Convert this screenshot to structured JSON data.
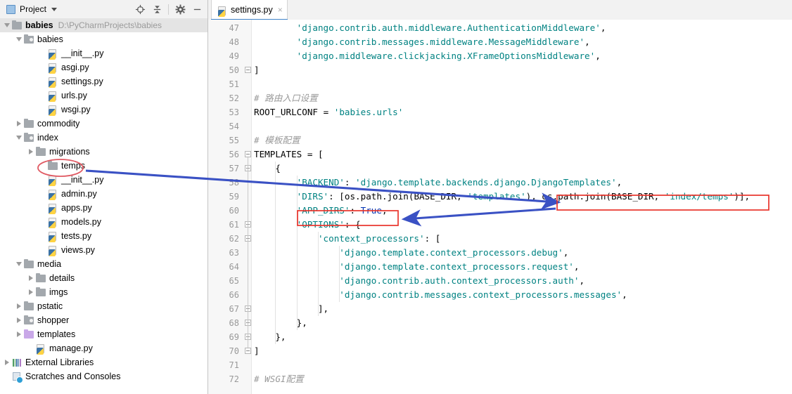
{
  "sidebar": {
    "title": "Project",
    "title_icon": "project-window-icon",
    "tools": [
      {
        "name": "locate-target-icon",
        "label": "Select Opened File"
      },
      {
        "name": "collapse-all-icon",
        "label": "Collapse All"
      },
      {
        "name": "gear-icon",
        "label": "Settings"
      },
      {
        "name": "minimize-icon",
        "label": "Hide"
      }
    ],
    "tree": [
      {
        "label": "babies",
        "path": "D:\\PyCharmProjects\\babies",
        "icon": "folder-icon",
        "state": "expanded",
        "depth": 0,
        "bold": true,
        "selected": true
      },
      {
        "label": "babies",
        "path": "",
        "icon": "module-folder-icon",
        "state": "expanded",
        "depth": 1,
        "bold": false,
        "selected": false
      },
      {
        "label": "__init__.py",
        "path": "",
        "icon": "python-file-icon",
        "state": "leaf",
        "depth": 3,
        "bold": false,
        "selected": false
      },
      {
        "label": "asgi.py",
        "path": "",
        "icon": "python-file-icon",
        "state": "leaf",
        "depth": 3,
        "bold": false,
        "selected": false
      },
      {
        "label": "settings.py",
        "path": "",
        "icon": "python-file-icon",
        "state": "leaf",
        "depth": 3,
        "bold": false,
        "selected": false
      },
      {
        "label": "urls.py",
        "path": "",
        "icon": "python-file-icon",
        "state": "leaf",
        "depth": 3,
        "bold": false,
        "selected": false
      },
      {
        "label": "wsgi.py",
        "path": "",
        "icon": "python-file-icon",
        "state": "leaf",
        "depth": 3,
        "bold": false,
        "selected": false
      },
      {
        "label": "commodity",
        "path": "",
        "icon": "folder-icon",
        "state": "collapsed",
        "depth": 1,
        "bold": false,
        "selected": false
      },
      {
        "label": "index",
        "path": "",
        "icon": "module-folder-icon",
        "state": "expanded",
        "depth": 1,
        "bold": false,
        "selected": false
      },
      {
        "label": "migrations",
        "path": "",
        "icon": "folder-icon",
        "state": "collapsed",
        "depth": 2,
        "bold": false,
        "selected": false
      },
      {
        "label": "temps",
        "path": "",
        "icon": "folder-icon",
        "state": "leaf",
        "depth": 3,
        "bold": false,
        "selected": false
      },
      {
        "label": "__init__.py",
        "path": "",
        "icon": "python-file-icon",
        "state": "leaf",
        "depth": 3,
        "bold": false,
        "selected": false
      },
      {
        "label": "admin.py",
        "path": "",
        "icon": "python-file-icon",
        "state": "leaf",
        "depth": 3,
        "bold": false,
        "selected": false
      },
      {
        "label": "apps.py",
        "path": "",
        "icon": "python-file-icon",
        "state": "leaf",
        "depth": 3,
        "bold": false,
        "selected": false
      },
      {
        "label": "models.py",
        "path": "",
        "icon": "python-file-icon",
        "state": "leaf",
        "depth": 3,
        "bold": false,
        "selected": false
      },
      {
        "label": "tests.py",
        "path": "",
        "icon": "python-file-icon",
        "state": "leaf",
        "depth": 3,
        "bold": false,
        "selected": false
      },
      {
        "label": "views.py",
        "path": "",
        "icon": "python-file-icon",
        "state": "leaf",
        "depth": 3,
        "bold": false,
        "selected": false
      },
      {
        "label": "media",
        "path": "",
        "icon": "folder-icon",
        "state": "expanded",
        "depth": 1,
        "bold": false,
        "selected": false
      },
      {
        "label": "details",
        "path": "",
        "icon": "folder-icon",
        "state": "collapsed",
        "depth": 2,
        "bold": false,
        "selected": false
      },
      {
        "label": "imgs",
        "path": "",
        "icon": "folder-icon",
        "state": "collapsed",
        "depth": 2,
        "bold": false,
        "selected": false
      },
      {
        "label": "pstatic",
        "path": "",
        "icon": "folder-icon",
        "state": "collapsed",
        "depth": 1,
        "bold": false,
        "selected": false
      },
      {
        "label": "shopper",
        "path": "",
        "icon": "module-folder-icon",
        "state": "collapsed",
        "depth": 1,
        "bold": false,
        "selected": false
      },
      {
        "label": "templates",
        "path": "",
        "icon": "template-folder-icon",
        "state": "collapsed",
        "depth": 1,
        "bold": false,
        "selected": false
      },
      {
        "label": "manage.py",
        "path": "",
        "icon": "python-file-icon",
        "state": "leaf",
        "depth": 2,
        "bold": false,
        "selected": false
      },
      {
        "label": "External Libraries",
        "path": "",
        "icon": "external-libraries-icon",
        "state": "collapsed",
        "depth": 0,
        "bold": false,
        "selected": false
      },
      {
        "label": "Scratches and Consoles",
        "path": "",
        "icon": "scratches-icon",
        "state": "leaf",
        "depth": 0,
        "bold": false,
        "selected": false
      }
    ]
  },
  "editor": {
    "tab": {
      "label": "settings.py",
      "icon": "python-file-icon",
      "close": "×",
      "active": true
    },
    "first_line_number": 47,
    "lines": [
      {
        "n": 47,
        "indent": 8,
        "fold": false,
        "tokens": [
          {
            "t": "'django.contrib.auth.middleware.AuthenticationMiddleware'",
            "c": "s-str"
          },
          {
            "t": ",",
            "c": "s-punct"
          }
        ]
      },
      {
        "n": 48,
        "indent": 8,
        "fold": false,
        "tokens": [
          {
            "t": "'django.contrib.messages.middleware.MessageMiddleware'",
            "c": "s-str"
          },
          {
            "t": ",",
            "c": "s-punct"
          }
        ]
      },
      {
        "n": 49,
        "indent": 8,
        "fold": false,
        "tokens": [
          {
            "t": "'django.middleware.clickjacking.XFrameOptionsMiddleware'",
            "c": "s-str"
          },
          {
            "t": ",",
            "c": "s-punct"
          }
        ]
      },
      {
        "n": 50,
        "indent": 0,
        "fold": true,
        "tokens": [
          {
            "t": "]",
            "c": "s-punct"
          }
        ]
      },
      {
        "n": 51,
        "indent": 0,
        "fold": false,
        "tokens": []
      },
      {
        "n": 52,
        "indent": 0,
        "fold": false,
        "tokens": [
          {
            "t": "# 路由入口设置",
            "c": "s-com"
          }
        ]
      },
      {
        "n": 53,
        "indent": 0,
        "fold": false,
        "tokens": [
          {
            "t": "ROOT_URLCONF",
            "c": "s-id"
          },
          {
            "t": " = ",
            "c": "s-punct"
          },
          {
            "t": "'babies.urls'",
            "c": "s-str"
          }
        ]
      },
      {
        "n": 54,
        "indent": 0,
        "fold": false,
        "tokens": []
      },
      {
        "n": 55,
        "indent": 0,
        "fold": false,
        "tokens": [
          {
            "t": "# 模板配置",
            "c": "s-com"
          }
        ]
      },
      {
        "n": 56,
        "indent": 0,
        "fold": true,
        "tokens": [
          {
            "t": "TEMPLATES",
            "c": "s-id"
          },
          {
            "t": " = [",
            "c": "s-punct"
          }
        ]
      },
      {
        "n": 57,
        "indent": 4,
        "fold": true,
        "tokens": [
          {
            "t": "{",
            "c": "s-punct"
          }
        ]
      },
      {
        "n": 58,
        "indent": 8,
        "fold": false,
        "tokens": [
          {
            "t": "'BACKEND'",
            "c": "s-str"
          },
          {
            "t": ": ",
            "c": "s-punct"
          },
          {
            "t": "'django.template.backends.django.DjangoTemplates'",
            "c": "s-str"
          },
          {
            "t": ",",
            "c": "s-punct"
          }
        ]
      },
      {
        "n": 59,
        "indent": 8,
        "fold": false,
        "tokens": [
          {
            "t": "'DIRS'",
            "c": "s-str"
          },
          {
            "t": ": [os.path.join(BASE_DIR, ",
            "c": "s-punct"
          },
          {
            "t": "'templates'",
            "c": "s-str"
          },
          {
            "t": "), os.path.join(BASE_DIR, ",
            "c": "s-punct"
          },
          {
            "t": "'index/temps'",
            "c": "s-str"
          },
          {
            "t": ")],",
            "c": "s-punct"
          }
        ]
      },
      {
        "n": 60,
        "indent": 8,
        "fold": false,
        "tokens": [
          {
            "t": "'APP_DIRS'",
            "c": "s-str"
          },
          {
            "t": ": ",
            "c": "s-punct"
          },
          {
            "t": "True",
            "c": "s-kw"
          },
          {
            "t": ",",
            "c": "s-punct"
          }
        ]
      },
      {
        "n": 61,
        "indent": 8,
        "fold": true,
        "tokens": [
          {
            "t": "'OPTIONS'",
            "c": "s-str"
          },
          {
            "t": ": {",
            "c": "s-punct"
          }
        ]
      },
      {
        "n": 62,
        "indent": 12,
        "fold": true,
        "tokens": [
          {
            "t": "'context_processors'",
            "c": "s-str"
          },
          {
            "t": ": [",
            "c": "s-punct"
          }
        ]
      },
      {
        "n": 63,
        "indent": 16,
        "fold": false,
        "tokens": [
          {
            "t": "'django.template.context_processors.debug'",
            "c": "s-str"
          },
          {
            "t": ",",
            "c": "s-punct"
          }
        ]
      },
      {
        "n": 64,
        "indent": 16,
        "fold": false,
        "tokens": [
          {
            "t": "'django.template.context_processors.request'",
            "c": "s-str"
          },
          {
            "t": ",",
            "c": "s-punct"
          }
        ]
      },
      {
        "n": 65,
        "indent": 16,
        "fold": false,
        "tokens": [
          {
            "t": "'django.contrib.auth.context_processors.auth'",
            "c": "s-str"
          },
          {
            "t": ",",
            "c": "s-punct"
          }
        ]
      },
      {
        "n": 66,
        "indent": 16,
        "fold": false,
        "tokens": [
          {
            "t": "'django.contrib.messages.context_processors.messages'",
            "c": "s-str"
          },
          {
            "t": ",",
            "c": "s-punct"
          }
        ]
      },
      {
        "n": 67,
        "indent": 12,
        "fold": true,
        "tokens": [
          {
            "t": "],",
            "c": "s-punct"
          }
        ]
      },
      {
        "n": 68,
        "indent": 8,
        "fold": true,
        "tokens": [
          {
            "t": "},",
            "c": "s-punct"
          }
        ]
      },
      {
        "n": 69,
        "indent": 4,
        "fold": true,
        "tokens": [
          {
            "t": "},",
            "c": "s-punct"
          }
        ]
      },
      {
        "n": 70,
        "indent": 0,
        "fold": true,
        "tokens": [
          {
            "t": "]",
            "c": "s-punct"
          }
        ]
      },
      {
        "n": 71,
        "indent": 0,
        "fold": false,
        "tokens": []
      },
      {
        "n": 72,
        "indent": 0,
        "fold": false,
        "tokens": [
          {
            "t": "# WSGI配置",
            "c": "s-com"
          }
        ]
      }
    ]
  },
  "annotations": {
    "accent_red": "#e8332a",
    "accent_ellipse": "#e05a63",
    "accent_blue": "#3a51c4",
    "items": [
      {
        "name": "temps-folder-highlight-ellipse",
        "kind": "ellipse"
      },
      {
        "name": "dirs-index-temps-highlight-box",
        "kind": "box"
      },
      {
        "name": "app-dirs-highlight-box",
        "kind": "box"
      },
      {
        "name": "arrow-temps-to-dirs",
        "kind": "arrow"
      },
      {
        "name": "arrow-dirs-to-app-dirs",
        "kind": "arrow"
      }
    ]
  }
}
